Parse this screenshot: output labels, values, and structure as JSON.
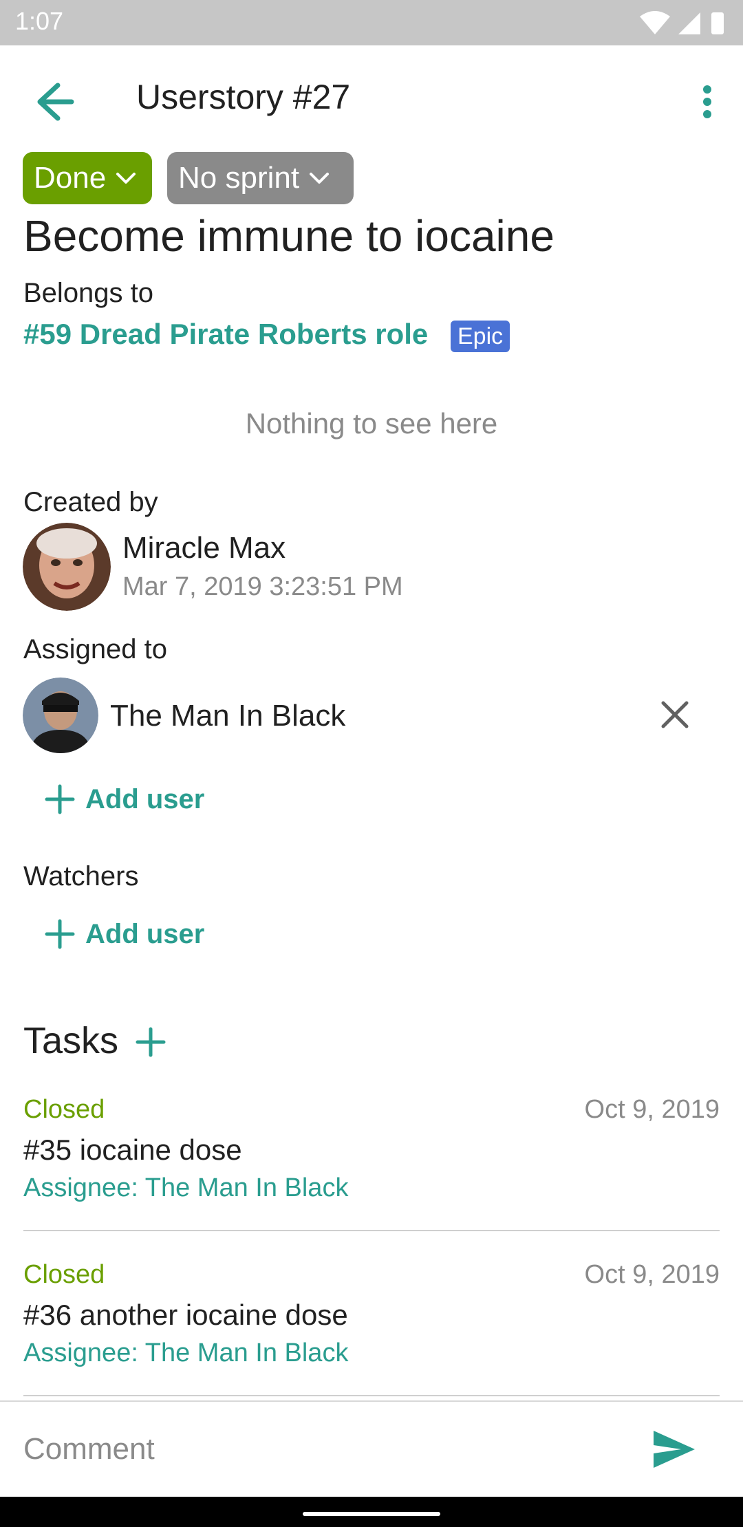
{
  "status_bar": {
    "time": "1:07"
  },
  "app_bar": {
    "title": "Userstory #27",
    "back_icon": "arrow-left-icon",
    "menu_icon": "more-vert-icon"
  },
  "chips": {
    "status": "Done",
    "sprint": "No sprint"
  },
  "story": {
    "title": "Become immune to iocaine",
    "belongs_to_label": "Belongs to",
    "epic_link": "#59 Dread Pirate Roberts role",
    "epic_badge": "Epic",
    "description_placeholder": "Nothing to see here"
  },
  "created": {
    "label": "Created by",
    "name": "Miracle Max",
    "date": "Mar 7, 2019 3:23:51 PM"
  },
  "assigned": {
    "label": "Assigned to",
    "name": "The Man In Black",
    "add_user": "Add user"
  },
  "watchers": {
    "label": "Watchers",
    "add_user": "Add user"
  },
  "tasks": {
    "heading": "Tasks",
    "items": [
      {
        "status": "Closed",
        "date": "Oct 9, 2019",
        "name": "#35 iocaine dose",
        "assignee": "Assignee: The Man In Black"
      },
      {
        "status": "Closed",
        "date": "Oct 9, 2019",
        "name": "#36 another iocaine dose",
        "assignee": "Assignee: The Man In Black"
      }
    ]
  },
  "comment": {
    "placeholder": "Comment",
    "send_icon": "send-icon"
  },
  "colors": {
    "accent": "#2a9d8f",
    "status_done": "#6a9f00",
    "sprint_chip": "#8a8a8a",
    "epic_badge": "#4a72d6"
  }
}
